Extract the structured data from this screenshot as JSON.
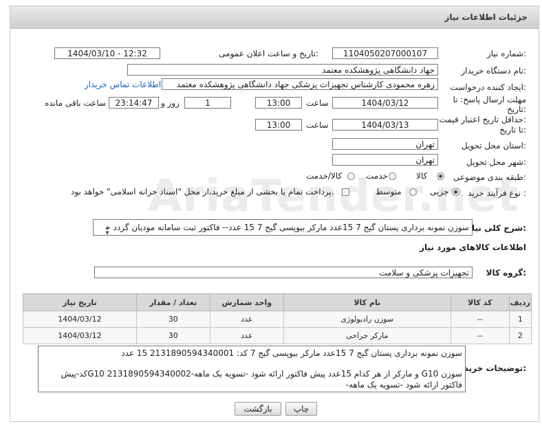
{
  "header": {
    "title": "جزئیات اطلاعات نیاز"
  },
  "fields": {
    "need_number_label": "شماره نیاز:",
    "need_number": "1104050207000107",
    "announce_label": "تاریخ و ساعت اعلان عمومی:",
    "announce_value": "1404/03/10 - 12:32",
    "buyer_org_label": "نام دستگاه خریدار:",
    "buyer_org": "جهاد دانشگاهی پژوهشکده معتمد",
    "requester_label": "ایجاد کننده درخواست:",
    "requester": "زهره محمودی کارشناس تجهیزات پزشکی جهاد دانشگاهی پژوهشکده معتمد",
    "contact_link": "اطلاعات تماس خریدار",
    "deadline_label_1": "مهلت ارسال پاسخ: تا",
    "deadline_label_2": "تاریخ:",
    "deadline_date": "1404/03/12",
    "time_label": "ساعت",
    "deadline_time": "13:00",
    "days_value": "1",
    "days_label": "روز و",
    "remaining_time": "23:14:47",
    "remaining_label": "ساعت باقی مانده",
    "validity_label_1": "حداقل تاریخ اعتبار قیمت:",
    "validity_label_2": "تا تاریخ:",
    "validity_date": "1404/03/13",
    "validity_time": "13:00",
    "province_label": "استان محل تحویل:",
    "province": "تهران",
    "city_label": "شهر محل تحویل:",
    "city": "تهران",
    "category_label": "طبقه بندی موضوعی:",
    "category_options": [
      "کالا",
      "خدمت",
      "کالا/خدمت"
    ],
    "category_selected": "کالا",
    "process_label": "نوع فرآیند خرید :",
    "process_options": [
      "جزیی",
      "متوسط"
    ],
    "process_selected": "جزیی",
    "payment_note": "پرداخت تمام یا بخشی از مبلغ خرید،از محل \"اسناد خزانه اسلامی\" خواهد بود.",
    "summary_label": "شرح کلی نیاز:",
    "summary": "سوزن نمونه برداری پستان گیج 7 15عدد مارکر بیوپسی گیج 7    15 عدد-- فاکتور ثبت سامانه مودیان گردد -",
    "goods_info_title": "اطلاعات کالاهای مورد نیاز",
    "goods_group_label": "گروه کالا:",
    "goods_group": "تجهیزات پزشکی و سلامت"
  },
  "table": {
    "headers": [
      "ردیف",
      "کد کالا",
      "نام کالا",
      "واحد شمارش",
      "تعداد / مقدار",
      "تاریخ نیاز"
    ],
    "rows": [
      [
        "1",
        "--",
        "سوزن رادیولوژی",
        "عدد",
        "30",
        "1404/03/12"
      ],
      [
        "2",
        "--",
        "مارکر جراحی",
        "عدد",
        "30",
        "1404/03/12"
      ]
    ]
  },
  "buyer_notes": {
    "label": "توضیحات خریدار:",
    "line1": "سوزن نمونه برداری پستان گیج 7 15عدد مارکر بیوپسی گیج 7  کد: 2131890594340001  15 عدد",
    "line2": "سوزن G10  و مارکر از هر کدام 15عدد پیش فاکتور ارائه شود -تسویه یک ماهه-2131890594340002 G10کد-پیش فاکتور ارائه شود -تسویه یک ماهه-"
  },
  "buttons": {
    "print": "چاپ",
    "back": "بازگشت"
  },
  "watermark": "AriaTender.net"
}
